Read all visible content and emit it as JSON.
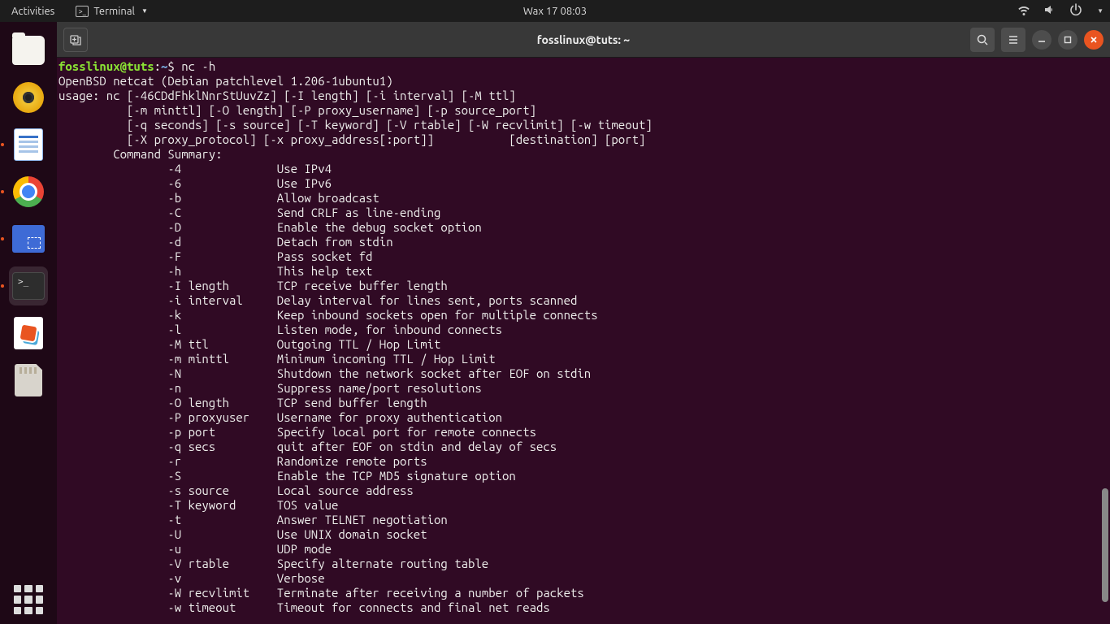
{
  "top_panel": {
    "activities": "Activities",
    "app_menu": "Terminal",
    "clock": "Wax 17  08:03"
  },
  "dock": {
    "items": [
      {
        "name": "files",
        "running": false
      },
      {
        "name": "rhythmbox",
        "running": false
      },
      {
        "name": "libreoffice-writer",
        "running": true
      },
      {
        "name": "google-chrome",
        "running": true
      },
      {
        "name": "screenshot",
        "running": true
      },
      {
        "name": "terminal",
        "running": true,
        "selected": true
      },
      {
        "name": "evince",
        "running": false
      },
      {
        "name": "usb-drive",
        "running": false
      }
    ]
  },
  "window": {
    "title": "fosslinux@tuts: ~",
    "prompt_user": "fosslinux@tuts",
    "prompt_path": "~",
    "command": "nc -h",
    "output_pre": "OpenBSD netcat (Debian patchlevel 1.206-1ubuntu1)\nusage: nc [-46CDdFhklNnrStUuvZz] [-I length] [-i interval] [-M ttl]\n          [-m minttl] [-O length] [-P proxy_username] [-p source_port]\n          [-q seconds] [-s source] [-T keyword] [-V rtable] [-W recvlimit] [-w timeout]\n          [-X proxy_protocol] [-x proxy_address[:port]]           [destination] [port]\n        Command Summary:",
    "flags": [
      {
        "flag": "-4",
        "desc": "Use IPv4"
      },
      {
        "flag": "-6",
        "desc": "Use IPv6"
      },
      {
        "flag": "-b",
        "desc": "Allow broadcast"
      },
      {
        "flag": "-C",
        "desc": "Send CRLF as line-ending"
      },
      {
        "flag": "-D",
        "desc": "Enable the debug socket option"
      },
      {
        "flag": "-d",
        "desc": "Detach from stdin"
      },
      {
        "flag": "-F",
        "desc": "Pass socket fd"
      },
      {
        "flag": "-h",
        "desc": "This help text"
      },
      {
        "flag": "-I length",
        "desc": "TCP receive buffer length"
      },
      {
        "flag": "-i interval",
        "desc": "Delay interval for lines sent, ports scanned"
      },
      {
        "flag": "-k",
        "desc": "Keep inbound sockets open for multiple connects"
      },
      {
        "flag": "-l",
        "desc": "Listen mode, for inbound connects"
      },
      {
        "flag": "-M ttl",
        "desc": "Outgoing TTL / Hop Limit"
      },
      {
        "flag": "-m minttl",
        "desc": "Minimum incoming TTL / Hop Limit"
      },
      {
        "flag": "-N",
        "desc": "Shutdown the network socket after EOF on stdin"
      },
      {
        "flag": "-n",
        "desc": "Suppress name/port resolutions"
      },
      {
        "flag": "-O length",
        "desc": "TCP send buffer length"
      },
      {
        "flag": "-P proxyuser",
        "desc": "Username for proxy authentication"
      },
      {
        "flag": "-p port",
        "desc": "Specify local port for remote connects"
      },
      {
        "flag": "-q secs",
        "desc": "quit after EOF on stdin and delay of secs"
      },
      {
        "flag": "-r",
        "desc": "Randomize remote ports"
      },
      {
        "flag": "-S",
        "desc": "Enable the TCP MD5 signature option"
      },
      {
        "flag": "-s source",
        "desc": "Local source address"
      },
      {
        "flag": "-T keyword",
        "desc": "TOS value"
      },
      {
        "flag": "-t",
        "desc": "Answer TELNET negotiation"
      },
      {
        "flag": "-U",
        "desc": "Use UNIX domain socket"
      },
      {
        "flag": "-u",
        "desc": "UDP mode"
      },
      {
        "flag": "-V rtable",
        "desc": "Specify alternate routing table"
      },
      {
        "flag": "-v",
        "desc": "Verbose"
      },
      {
        "flag": "-W recvlimit",
        "desc": "Terminate after receiving a number of packets"
      },
      {
        "flag": "-w timeout",
        "desc": "Timeout for connects and final net reads"
      }
    ]
  }
}
